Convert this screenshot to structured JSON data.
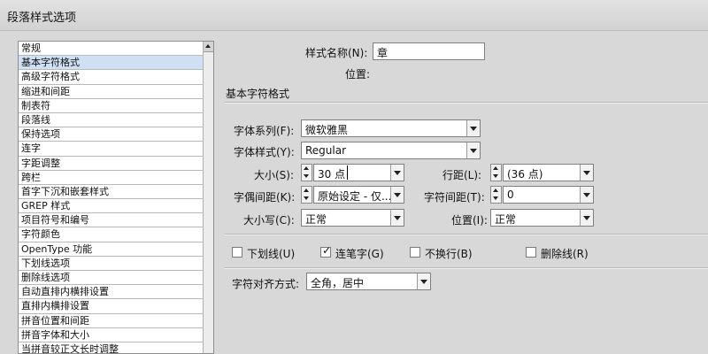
{
  "window": {
    "title": "段落样式选项"
  },
  "sidebar": {
    "items": [
      "常规",
      "基本字符格式",
      "高级字符格式",
      "缩进和间距",
      "制表符",
      "段落线",
      "保持选项",
      "连字",
      "字距调整",
      "跨栏",
      "首字下沉和嵌套样式",
      "GREP 样式",
      "项目符号和编号",
      "字符颜色",
      "OpenType 功能",
      "下划线选项",
      "删除线选项",
      "自动直排内横排设置",
      "直排内横排设置",
      "拼音位置和间距",
      "拼音字体和大小",
      "当拼音较正文长时调整"
    ],
    "selected_index": 1
  },
  "header": {
    "style_name_label": "样式名称(N):",
    "style_name_value": "章",
    "location_label": "位置:",
    "section_title": "基本字符格式"
  },
  "form": {
    "font_family_label": "字体系列(F):",
    "font_family_value": "微软雅黑",
    "font_style_label": "字体样式(Y):",
    "font_style_value": "Regular",
    "size_label": "大小(S):",
    "size_value": "30 点",
    "leading_label": "行距(L):",
    "leading_value": "(36 点)",
    "kerning_label": "字偶间距(K):",
    "kerning_value": "原始设定 - 仅...",
    "tracking_label": "字符间距(T):",
    "tracking_value": "0",
    "case_label": "大小写(C):",
    "case_value": "正常",
    "position_label": "位置(I):",
    "position_value": "正常"
  },
  "checkboxes": {
    "underline": {
      "label": "下划线(U)",
      "checked": false
    },
    "ligatures": {
      "label": "连笔字(G)",
      "checked": true
    },
    "no_break": {
      "label": "不换行(B)",
      "checked": false
    },
    "strikethrough": {
      "label": "删除线(R)",
      "checked": false
    }
  },
  "alignment": {
    "label": "字符对齐方式:",
    "value": "全角，居中"
  }
}
